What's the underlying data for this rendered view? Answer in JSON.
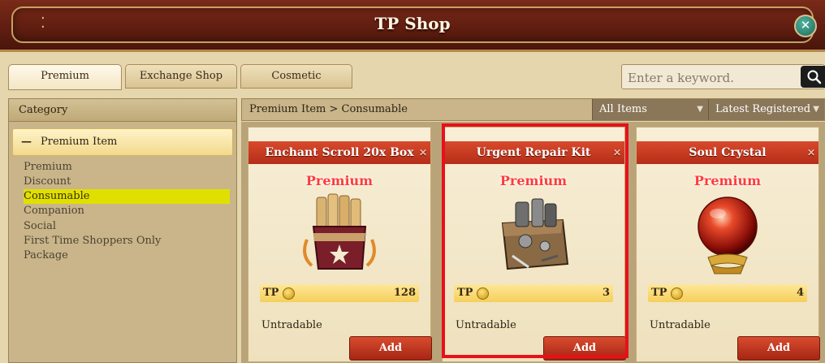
{
  "window": {
    "title": "TP Shop"
  },
  "tabs": [
    {
      "label": "Premium",
      "active": true
    },
    {
      "label": "Exchange Shop",
      "active": false
    },
    {
      "label": "Cosmetic",
      "active": false
    }
  ],
  "search": {
    "placeholder": "Enter a keyword."
  },
  "sidebar": {
    "header": "Category",
    "main_category": "Premium Item",
    "items": [
      "Premium",
      "Discount",
      "Consumable",
      "Companion",
      "Social",
      "First Time Shoppers Only",
      "Package"
    ],
    "selected_item": "Consumable"
  },
  "breadcrumb": "Premium Item > Consumable",
  "filters": {
    "scope": "All Items",
    "sort": "Latest Registered"
  },
  "products": [
    {
      "name": "Enchant Scroll 20x Box",
      "badge": "Premium",
      "currency": "TP",
      "price": "128",
      "tradability": "Untradable",
      "button": "Add",
      "icon": "scroll-box-icon"
    },
    {
      "name": "Urgent Repair Kit",
      "badge": "Premium",
      "currency": "TP",
      "price": "3",
      "tradability": "Untradable",
      "button": "Add",
      "icon": "repair-kit-icon",
      "highlighted": true
    },
    {
      "name": "Soul Crystal",
      "badge": "Premium",
      "currency": "TP",
      "price": "4",
      "tradability": "Untradable",
      "button": "Add",
      "icon": "soul-crystal-icon"
    }
  ],
  "colors": {
    "accent_red": "#c33a1f",
    "highlight": "#e8101a",
    "selected_item": "#e0e000"
  }
}
